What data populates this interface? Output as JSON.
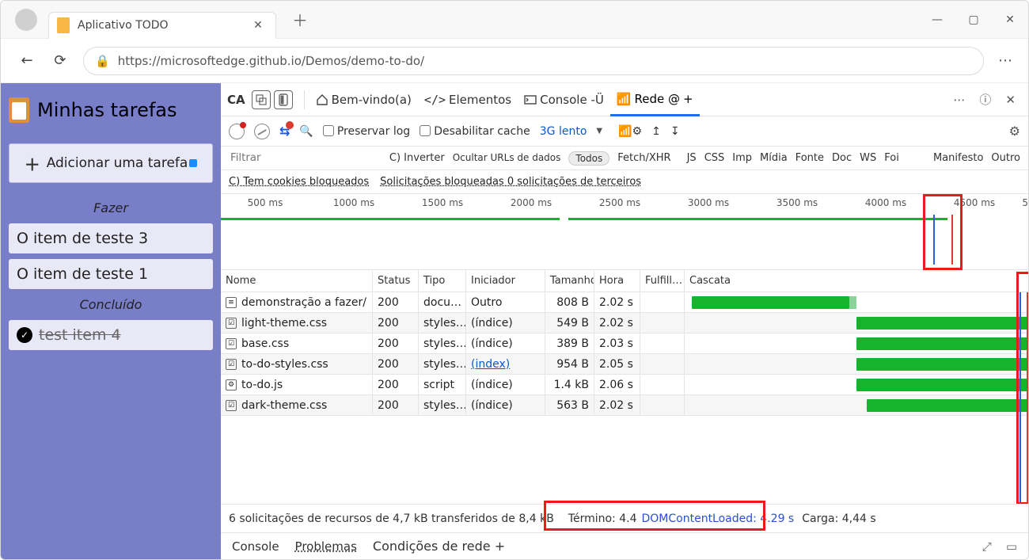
{
  "browser": {
    "tab_title": "Aplicativo TODO",
    "url": "https://microsoftedge.github.io/Demos/demo-to-do/"
  },
  "todo": {
    "title": "Minhas tarefas",
    "add_label": "Adicionar uma tarefa",
    "section_todo": "Fazer",
    "section_done": "Concluído",
    "tasks_todo": [
      "O item de teste 3",
      "O item de teste 1"
    ],
    "tasks_done": [
      "test item 4"
    ]
  },
  "devtools": {
    "prefix": "CA",
    "welcome": "Bem-vindo(a)",
    "elements": "Elementos",
    "console": "Console -Ü",
    "network": "Rede @",
    "toolbar": {
      "preserve": "Preservar log",
      "disable_cache": "Desabilitar cache",
      "throttle": "3G lento"
    },
    "filter": {
      "placeholder": "Filtrar",
      "invert": "C) Inverter",
      "hide_data": "Ocultar URLs de dados",
      "types": [
        "Todos",
        "Fetch/XHR",
        "JS",
        "CSS",
        "Imp",
        "Mídia",
        "Fonte",
        "Doc",
        "WS",
        "Foi",
        "Manifesto",
        "Outro"
      ]
    },
    "row3": {
      "cookies": "C) Tem cookies bloqueados",
      "blocked": "Solicitações bloqueadas 0 solicitações de terceiros"
    },
    "timeline_ticks": [
      "500 ms",
      "1000 ms",
      "1500 ms",
      "2000 ms",
      "2500 ms",
      "3000 ms",
      "3500 ms",
      "4000 ms",
      "4500 ms",
      "5"
    ],
    "columns": {
      "name": "Nome",
      "status": "Status",
      "type": "Tipo",
      "initiator": "Iniciador",
      "size": "Tamanho",
      "time": "Hora",
      "fulfill": "Fulfill…",
      "waterfall": "Cascata"
    },
    "rows": [
      {
        "name": "demonstração a fazer/",
        "status": "200",
        "type": "docu…",
        "initiator": "Outro",
        "size": "808 B",
        "time": "2.02 s",
        "w_start": 2,
        "w_end": 48,
        "light_end": 50
      },
      {
        "name": "light-theme.css",
        "status": "200",
        "type": "styles…",
        "initiator": "(índice)",
        "size": "549 B",
        "time": "2.02 s",
        "w_start": 50,
        "w_end": 100
      },
      {
        "name": "base.css",
        "status": "200",
        "type": "styles…",
        "initiator": "(índice)",
        "size": "389 B",
        "time": "2.03 s",
        "w_start": 50,
        "w_end": 100
      },
      {
        "name": "to-do-styles.css",
        "status": "200",
        "type": "styles…",
        "initiator": "(index)",
        "initiator_link": true,
        "size": "954 B",
        "time": "2.05 s",
        "w_start": 50,
        "w_end": 100
      },
      {
        "name": "to-do.js",
        "status": "200",
        "type": "script",
        "initiator": "(índice)",
        "size": "1.4 kB",
        "time": "2.06 s",
        "w_start": 50,
        "w_end": 100
      },
      {
        "name": "dark-theme.css",
        "status": "200",
        "type": "styles…",
        "initiator": "(índice)",
        "size": "563 B",
        "time": "2.02 s",
        "w_start": 53,
        "w_end": 100
      }
    ],
    "status": {
      "summary": "6 solicitações de recursos de 4,7 kB transferidos de 8,4 kB",
      "finish_label": "Término: 4.4",
      "dom": "DOMContentLoaded: 4.29 s",
      "load": "Carga: 4,44 s"
    },
    "drawer": {
      "console": "Console",
      "problems": "Problemas",
      "conditions": "Condições de rede +"
    }
  }
}
